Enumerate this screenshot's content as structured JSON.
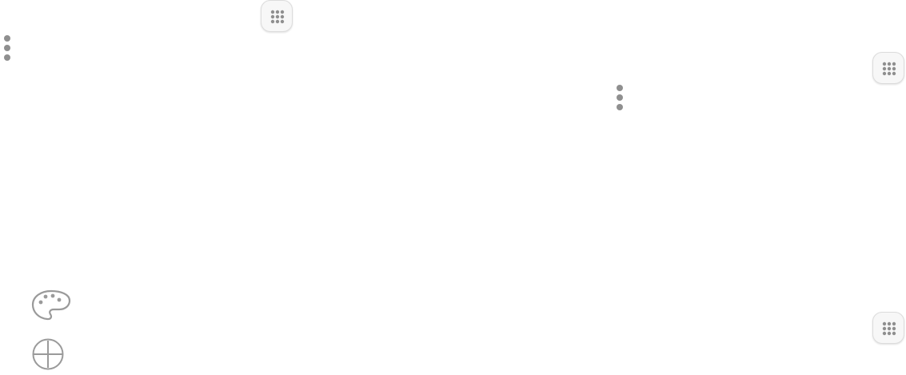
{
  "icons": {
    "apps_top": "apps-grid-icon",
    "more_left": "more-vertical-icon",
    "apps_right_top": "apps-grid-icon",
    "more_right": "more-vertical-icon",
    "palette": "palette-icon",
    "add": "add-circle-icon",
    "apps_right_bottom": "apps-grid-icon"
  },
  "colors": {
    "icon_gray": "#8f8f8f",
    "outline_gray": "#9a9a9a",
    "button_bg": "#f7f7f7",
    "button_border": "#dcdcdc"
  }
}
